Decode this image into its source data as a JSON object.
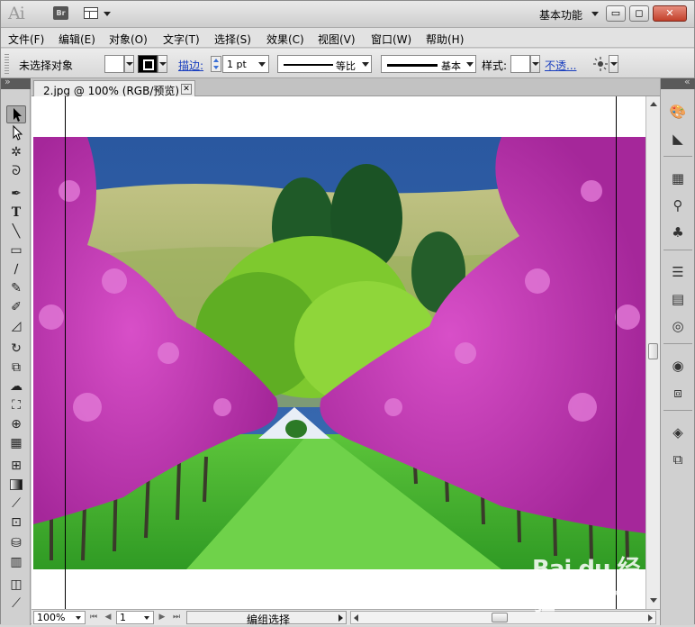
{
  "titlebar": {
    "logo": "Ai",
    "bridge": "Br",
    "workspace": "基本功能",
    "buttons": {
      "minimize": "▭",
      "maximize": "◻",
      "close": "✕"
    }
  },
  "menu": [
    "文件(F)",
    "编辑(E)",
    "对象(O)",
    "文字(T)",
    "选择(S)",
    "效果(C)",
    "视图(V)",
    "窗口(W)",
    "帮助(H)"
  ],
  "control": {
    "selection_label": "未选择对象",
    "stroke_label": "描边:",
    "stroke_weight": "1 pt",
    "profile_label": "等比",
    "brush_label": "基本",
    "style_label": "样式:",
    "opacity_label": "不透..."
  },
  "document": {
    "tab_title": "2.jpg @ 100% (RGB/预览)",
    "close": "✕"
  },
  "status": {
    "zoom": "100%",
    "artboard": "1",
    "status_text": "编组选择"
  },
  "watermark": {
    "brand": "Bai du 经验",
    "sub": "jingyan.baidu.com"
  },
  "colors": {
    "blossom": "#c03cb0",
    "grass": "#3fae2e",
    "hills": "#a8b070",
    "sky": "#2f5fa8"
  },
  "tools": [
    "selection-tool",
    "direct-selection-tool",
    "magic-wand-tool",
    "lasso-tool",
    "pen-tool",
    "type-tool",
    "line-tool",
    "rectangle-tool",
    "paintbrush-tool",
    "pencil-tool",
    "blob-brush-tool",
    "eraser-tool",
    "rotate-tool",
    "scale-tool",
    "warp-tool",
    "free-transform-tool",
    "shape-builder-tool",
    "perspective-grid-tool",
    "mesh-tool",
    "gradient-tool",
    "eyedropper-tool",
    "blend-tool",
    "symbol-sprayer-tool",
    "column-graph-tool",
    "artboard-tool",
    "slice-tool",
    "hand-tool"
  ],
  "panels": [
    "color-panel",
    "color-guide-panel",
    "swatches-panel",
    "brushes-panel",
    "symbols-panel",
    "stroke-panel",
    "gradient-panel",
    "transparency-panel",
    "appearance-panel",
    "graphic-styles-panel",
    "layers-panel",
    "artboards-panel"
  ]
}
